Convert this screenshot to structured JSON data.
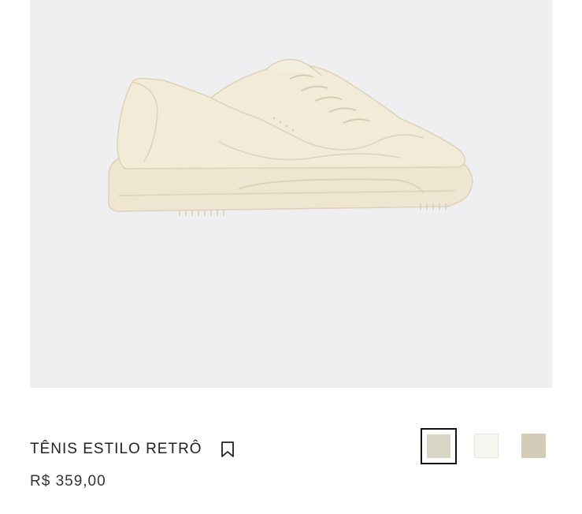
{
  "product": {
    "title": "TÊNIS ESTILO RETRÔ",
    "price": "R$ 359,00",
    "image_alt": "sneaker"
  },
  "colors": {
    "background": "#efeef0",
    "shoe": "#efe9d6",
    "swatches": [
      "#d8d5c4",
      "#f6f6f1",
      "#d4cbb8"
    ]
  },
  "icons": {
    "bookmark": "bookmark-icon"
  }
}
